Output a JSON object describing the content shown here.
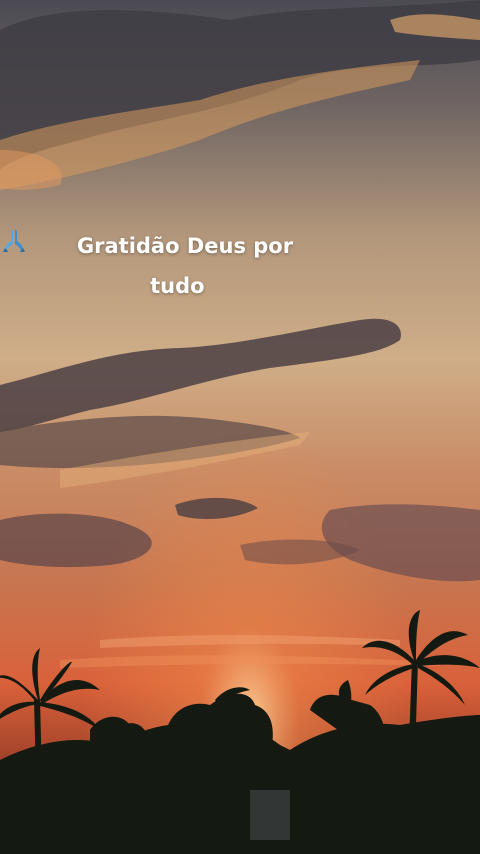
{
  "caption": {
    "line1": "Gratidão Deus por",
    "line2": "tudo",
    "emoji_icon": "folded-hands-icon"
  },
  "colors": {
    "sky_top": "#4a4a52",
    "sky_mid": "#c9a27e",
    "sky_low": "#d9744a",
    "sun": "#fff3d0",
    "silhouette": "#141a12",
    "text": "#ffffff",
    "emoji": "#5aa8e0"
  }
}
